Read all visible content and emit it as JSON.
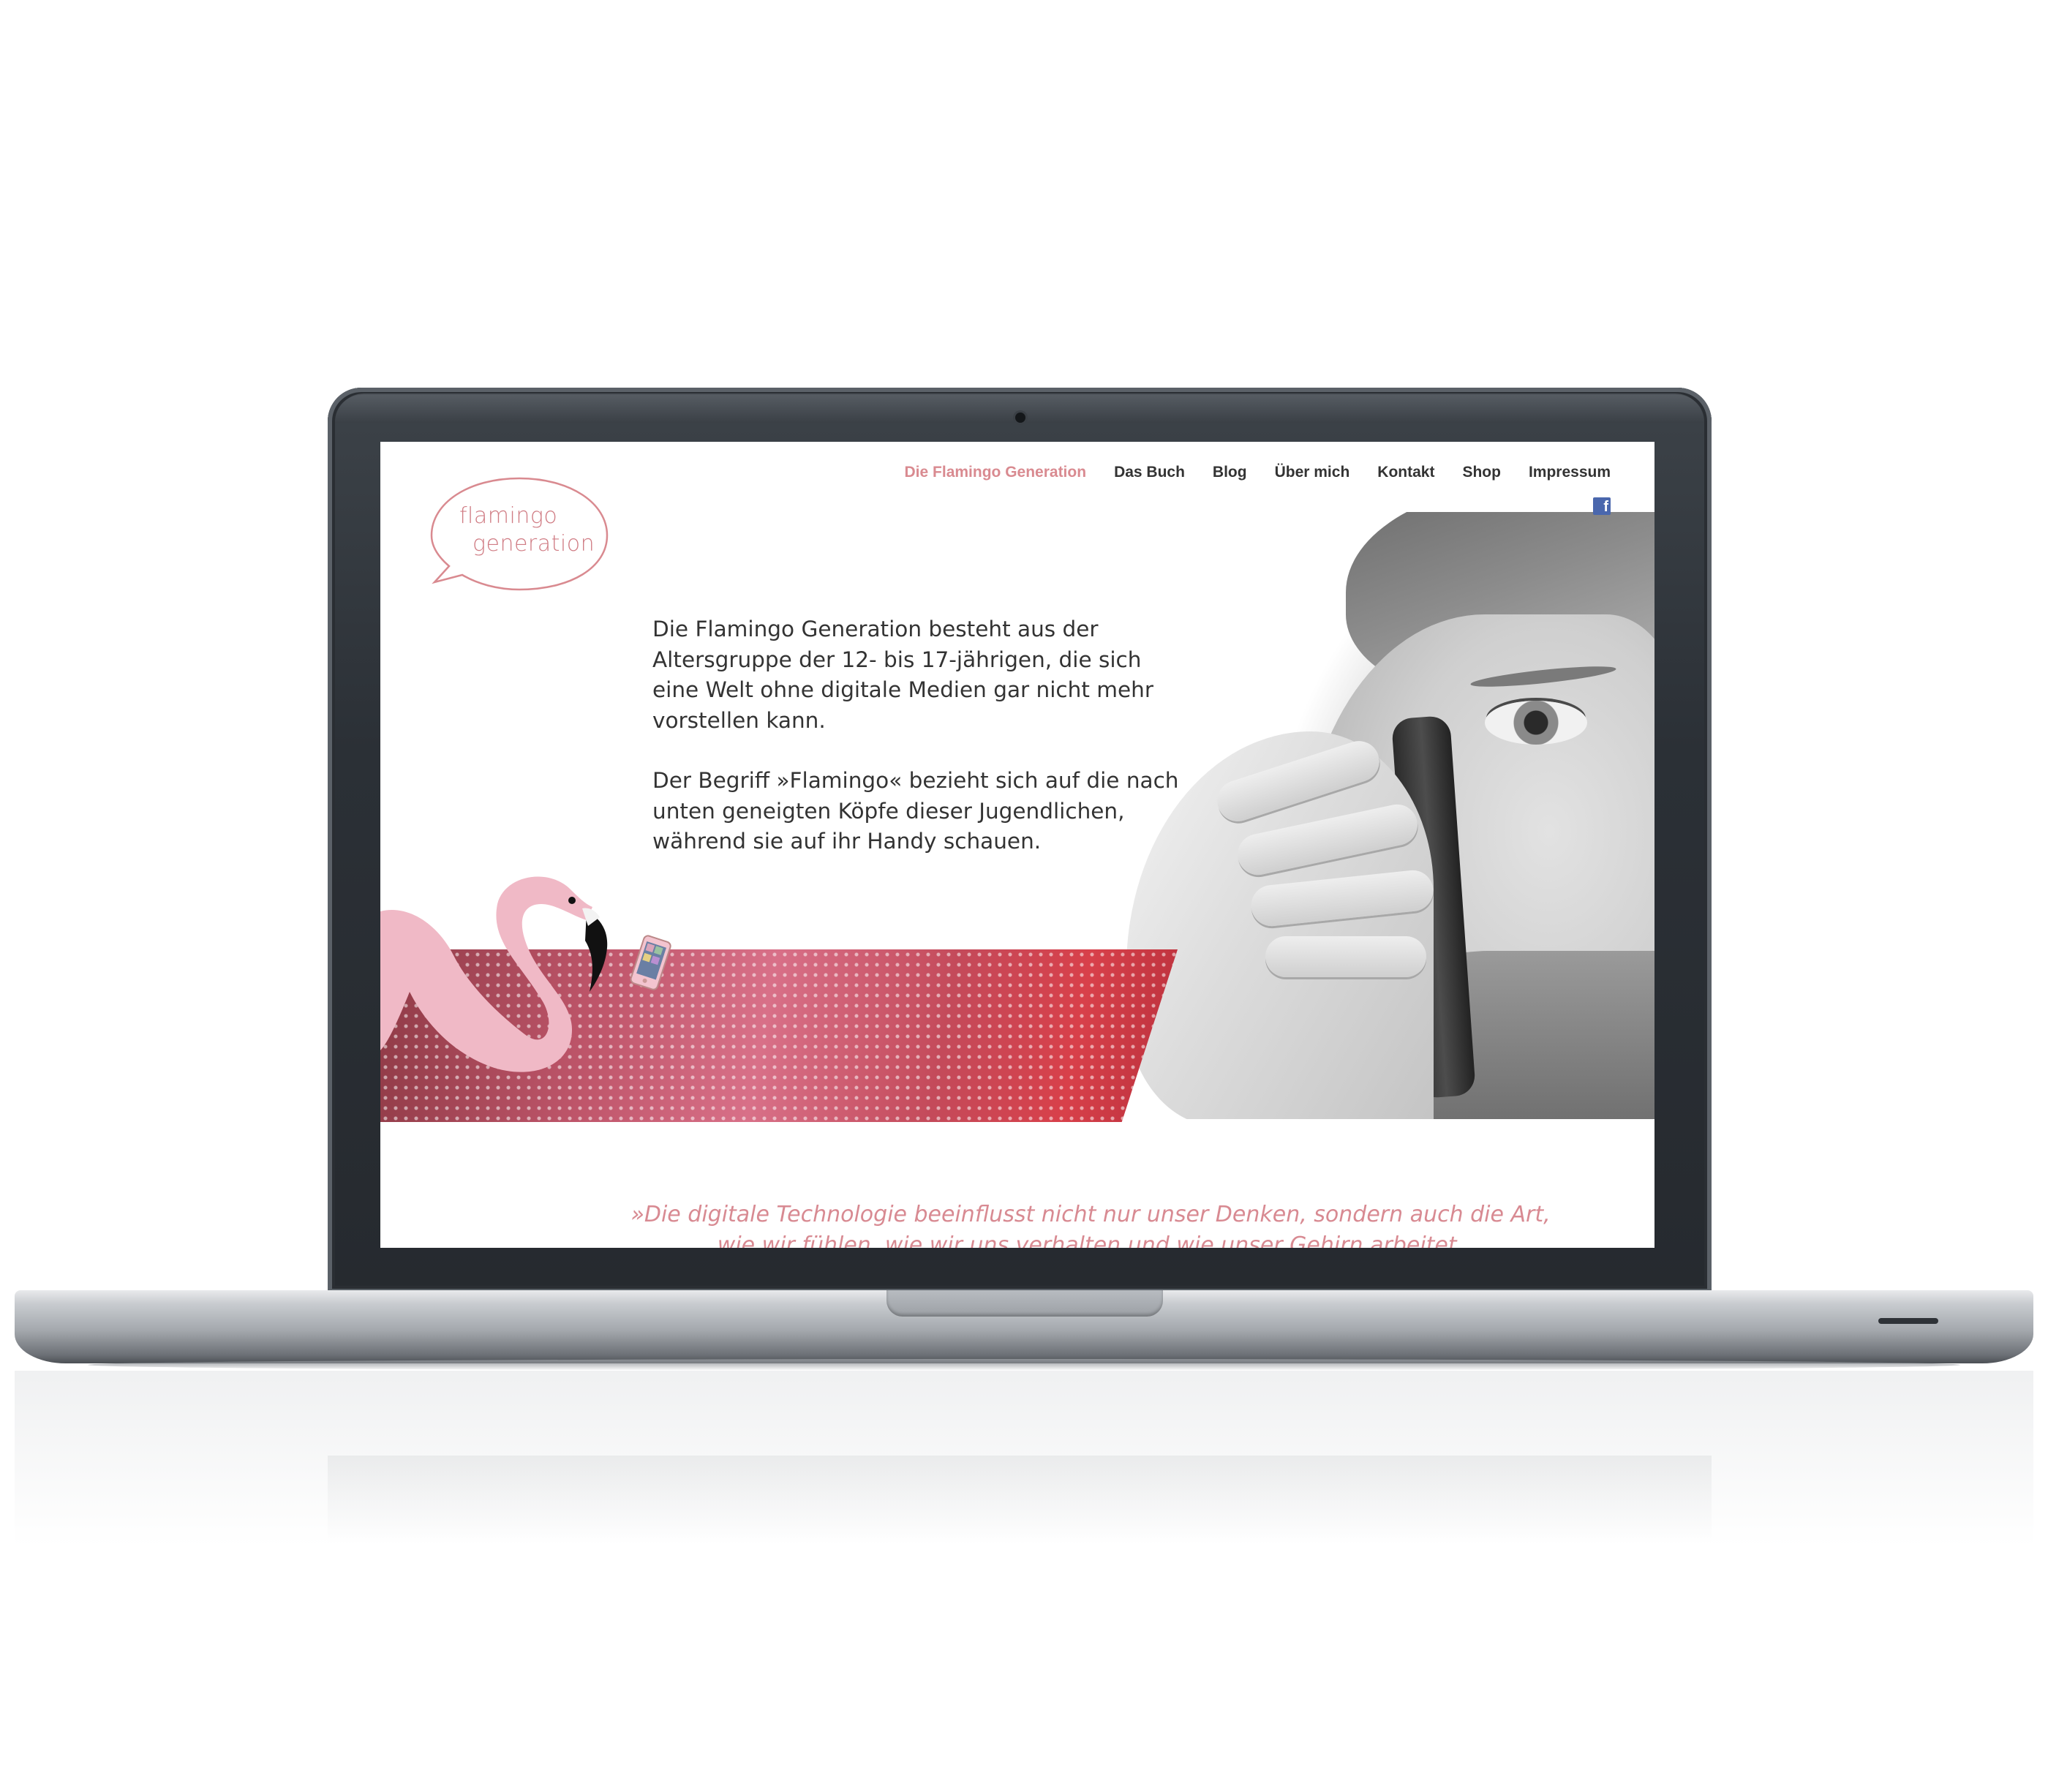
{
  "logo": {
    "line1": "flamingo",
    "line2": "generation"
  },
  "nav": {
    "items": [
      {
        "label": "Die Flamingo Generation",
        "active": true
      },
      {
        "label": "Das Buch",
        "active": false
      },
      {
        "label": "Blog",
        "active": false
      },
      {
        "label": "Über mich",
        "active": false
      },
      {
        "label": "Kontakt",
        "active": false
      },
      {
        "label": "Shop",
        "active": false
      },
      {
        "label": "Impressum",
        "active": false
      }
    ],
    "social_icon": "facebook-icon"
  },
  "intro": {
    "paragraph1": "Die Flamingo Generation besteht aus der Altersgruppe der 12- bis 17-jährigen, die sich eine Welt ohne digitale Medien gar nicht mehr vorstellen kann.",
    "paragraph2": "Der Begriff »Flamingo« bezieht sich auf die nach unten geneigten Köpfe dieser Jugendlichen, während sie auf ihr Handy schauen."
  },
  "quote": {
    "line1": "»Die digitale Technologie beeinflusst nicht nur unser Denken, sondern auch die Art,",
    "line2": "wie wir fühlen, wie wir uns verhalten und wie unser Gehirn arbeitet."
  },
  "colors": {
    "accent": "#d98a90",
    "text": "#333333",
    "facebook": "#4a67ad",
    "band": "#c0566b"
  }
}
